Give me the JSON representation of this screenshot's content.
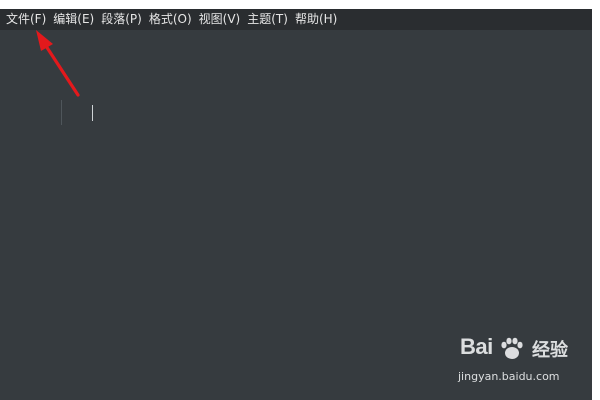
{
  "menubar": {
    "items": [
      {
        "label": "文件(F)"
      },
      {
        "label": "编辑(E)"
      },
      {
        "label": "段落(P)"
      },
      {
        "label": "格式(O)"
      },
      {
        "label": "视图(V)"
      },
      {
        "label": "主题(T)"
      },
      {
        "label": "帮助(H)"
      }
    ]
  },
  "annotation": {
    "arrow_color": "#e3191c"
  },
  "watermark": {
    "brand": "Bai",
    "brand_cn": "经验",
    "url": "jingyan.baidu.com"
  },
  "colors": {
    "editor_bg": "#363b3f",
    "menubar_bg": "#2a2d30",
    "menu_text": "#e6e6e6"
  }
}
